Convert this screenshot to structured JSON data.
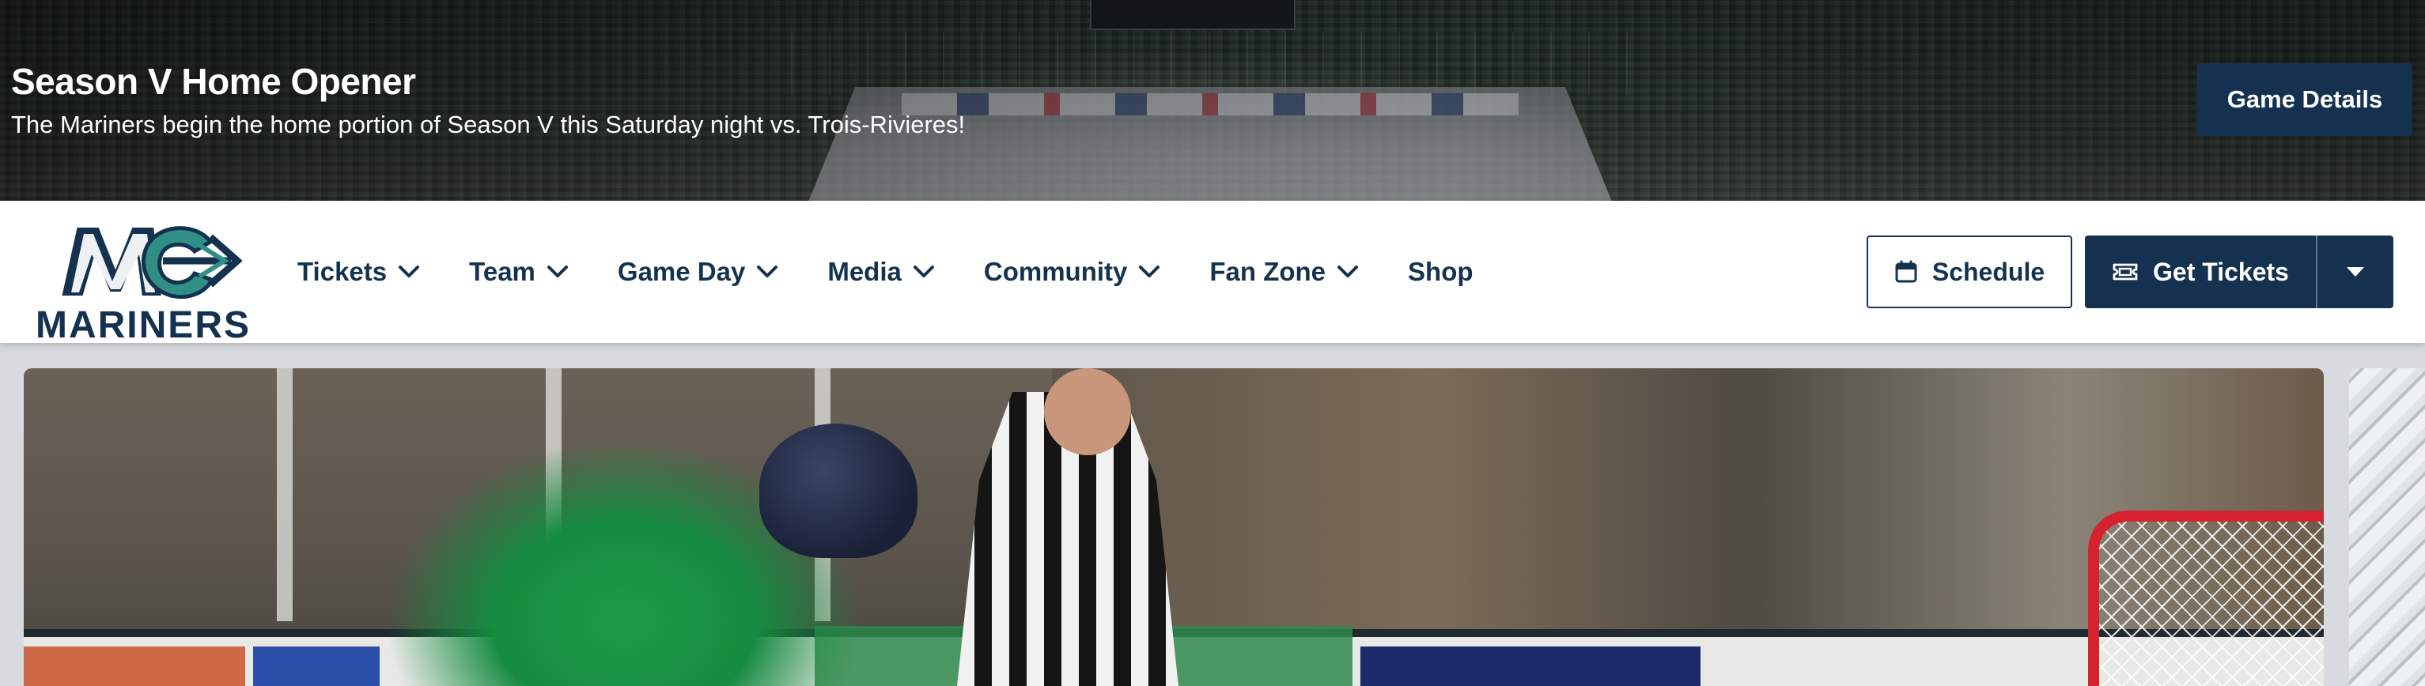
{
  "banner": {
    "title": "Season V Home Opener",
    "subtitle": "The Mariners begin the home portion of Season V this Saturday night vs. Trois-Rivieres!",
    "cta_label": "Game Details"
  },
  "logo": {
    "wordmark": "MARINERS"
  },
  "nav": {
    "items": [
      {
        "label": "Tickets",
        "has_dropdown": true
      },
      {
        "label": "Team",
        "has_dropdown": true
      },
      {
        "label": "Game Day",
        "has_dropdown": true
      },
      {
        "label": "Media",
        "has_dropdown": true
      },
      {
        "label": "Community",
        "has_dropdown": true
      },
      {
        "label": "Fan Zone",
        "has_dropdown": true
      },
      {
        "label": "Shop",
        "has_dropdown": false
      }
    ]
  },
  "actions": {
    "schedule_label": "Schedule",
    "schedule_icon": "calendar-icon",
    "tickets_label": "Get Tickets",
    "tickets_icon": "ticket-icon",
    "tickets_menu_icon": "caret-down-icon"
  },
  "colors": {
    "navy": "#14324f",
    "teal": "#2f8f86",
    "white": "#ffffff"
  }
}
